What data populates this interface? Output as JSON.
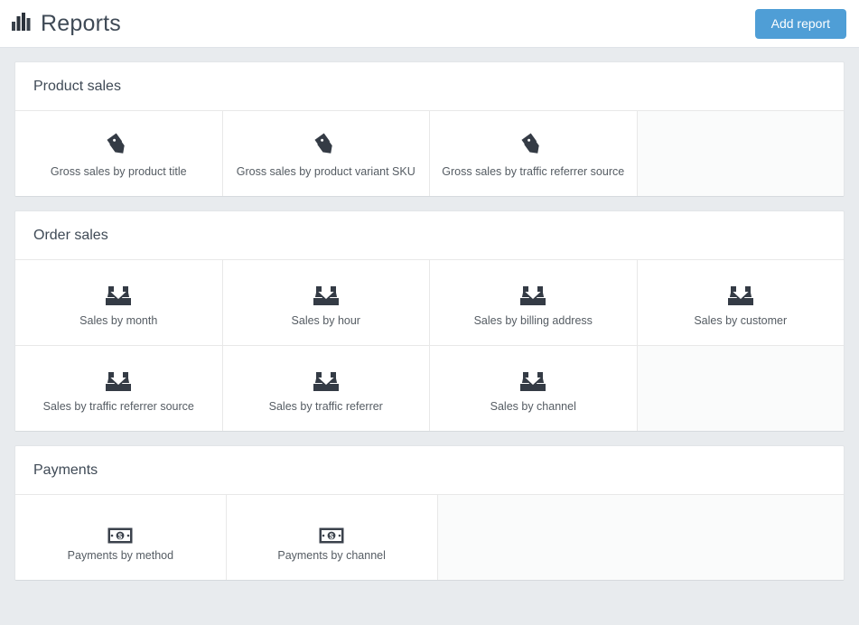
{
  "topbar": {
    "icon": "bar-chart-icon",
    "title": "Reports",
    "add_button_label": "Add report",
    "accent_color": "#4f9ed6"
  },
  "sections": [
    {
      "title": "Product sales",
      "icon": "tags-icon",
      "columns": 4,
      "items": [
        {
          "label": "Gross sales by product title"
        },
        {
          "label": "Gross sales by product variant SKU"
        },
        {
          "label": "Gross sales by traffic referrer source"
        }
      ],
      "empty_cells": 1
    },
    {
      "title": "Order sales",
      "icon": "inbox-down-icon",
      "columns": 4,
      "items": [
        {
          "label": "Sales by month"
        },
        {
          "label": "Sales by hour"
        },
        {
          "label": "Sales by billing address"
        },
        {
          "label": "Sales by customer"
        },
        {
          "label": "Sales by traffic referrer source"
        },
        {
          "label": "Sales by traffic referrer"
        },
        {
          "label": "Sales by channel"
        }
      ],
      "empty_cells": 1
    },
    {
      "title": "Payments",
      "icon": "banknote-icon",
      "columns": 4,
      "items": [
        {
          "label": "Payments by method"
        },
        {
          "label": "Payments by channel"
        }
      ],
      "empty_cells": 2
    }
  ]
}
